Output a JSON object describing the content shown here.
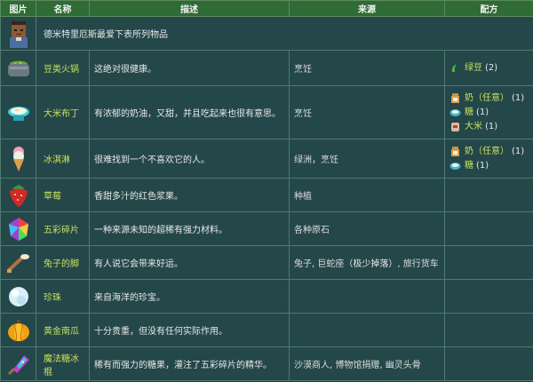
{
  "headers": [
    "图片",
    "名称",
    "描述",
    "来源",
    "配方"
  ],
  "intro": "德米特里厄斯最爱下表所列物品",
  "rows": [
    {
      "icon": "bean-hotpot-icon",
      "name": "豆类火锅",
      "desc": "这绝对很健康。",
      "source": "烹饪",
      "recipe": [
        {
          "icon": "green-bean-icon",
          "label": "绿豆",
          "count": "(2)"
        }
      ]
    },
    {
      "icon": "rice-pudding-icon",
      "name": "大米布丁",
      "desc": "有浓郁的奶油，又甜，并且吃起来也很有意思。",
      "source": "烹饪",
      "recipe": [
        {
          "icon": "milk-icon",
          "label": "奶（任意）",
          "count": "(1)"
        },
        {
          "icon": "sugar-icon",
          "label": "糖",
          "count": "(1)"
        },
        {
          "icon": "rice-icon",
          "label": "大米",
          "count": "(1)"
        }
      ]
    },
    {
      "icon": "ice-cream-icon",
      "name": "冰淇淋",
      "desc": "很难找到一个不喜欢它的人。",
      "source": "绿洲，烹饪",
      "recipe": [
        {
          "icon": "milk-icon",
          "label": "奶（任意）",
          "count": "(1)"
        },
        {
          "icon": "sugar-icon",
          "label": "糖",
          "count": "(1)"
        }
      ]
    },
    {
      "icon": "strawberry-icon",
      "name": "草莓",
      "desc": "香甜多汁的红色浆果。",
      "source": "种植",
      "recipe": []
    },
    {
      "icon": "prismatic-shard-icon",
      "name": "五彩碎片",
      "desc": "一种来源未知的超稀有强力材料。",
      "source": "各种原石",
      "recipe": []
    },
    {
      "icon": "rabbit-foot-icon",
      "name": "兔子的脚",
      "desc": "有人说它会带来好运。",
      "source": "兔子, 巨蛇座（极少掉落）, 旅行货车",
      "recipe": []
    },
    {
      "icon": "pearl-icon",
      "name": "珍珠",
      "desc": "来自海洋的珍宝。",
      "source": "",
      "recipe": []
    },
    {
      "icon": "golden-pumpkin-icon",
      "name": "黄金南瓜",
      "desc": "十分贵重，但没有任何实际作用。",
      "source": "",
      "recipe": []
    },
    {
      "icon": "magic-rock-candy-icon",
      "name": "魔法糖冰棍",
      "desc": "稀有而强力的糖果，灌注了五彩碎片的精华。",
      "source": "沙漠商人, 博物馆捐赠, 幽灵头骨",
      "recipe": []
    }
  ],
  "source_links": {
    "row0": "烹饪",
    "row1": "烹饪",
    "row2_a": "绿洲",
    "row2_b": "烹饪",
    "row3": "种植",
    "row5_a": "兔子",
    "row5_b": "巨蛇座",
    "row5_c": "（极少掉落）",
    "row5_d": "旅行货车",
    "row8_a": "沙漠商人",
    "row8_b": "博物馆捐赠",
    "row8_c": "幽灵头骨"
  }
}
